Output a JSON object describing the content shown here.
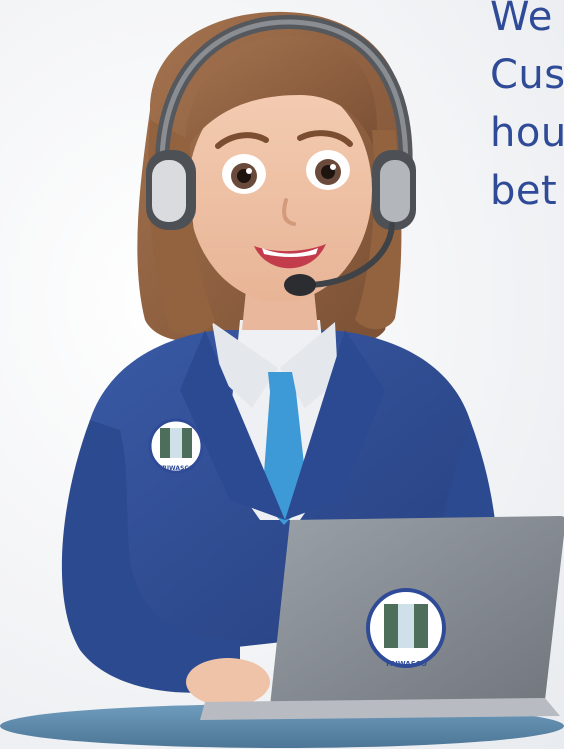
{
  "headline": {
    "lines": [
      "We",
      "Cus",
      "hou",
      "bet"
    ]
  },
  "badges": {
    "lapel_text": "TRIWASCO",
    "laptop_text": "TRIWASCO"
  },
  "colors": {
    "headline": "#2f4b98",
    "blazer": "#2f4e96",
    "tie": "#3d9ad6",
    "laptop": "#8a8f96",
    "desk": "#5f8fb1"
  }
}
